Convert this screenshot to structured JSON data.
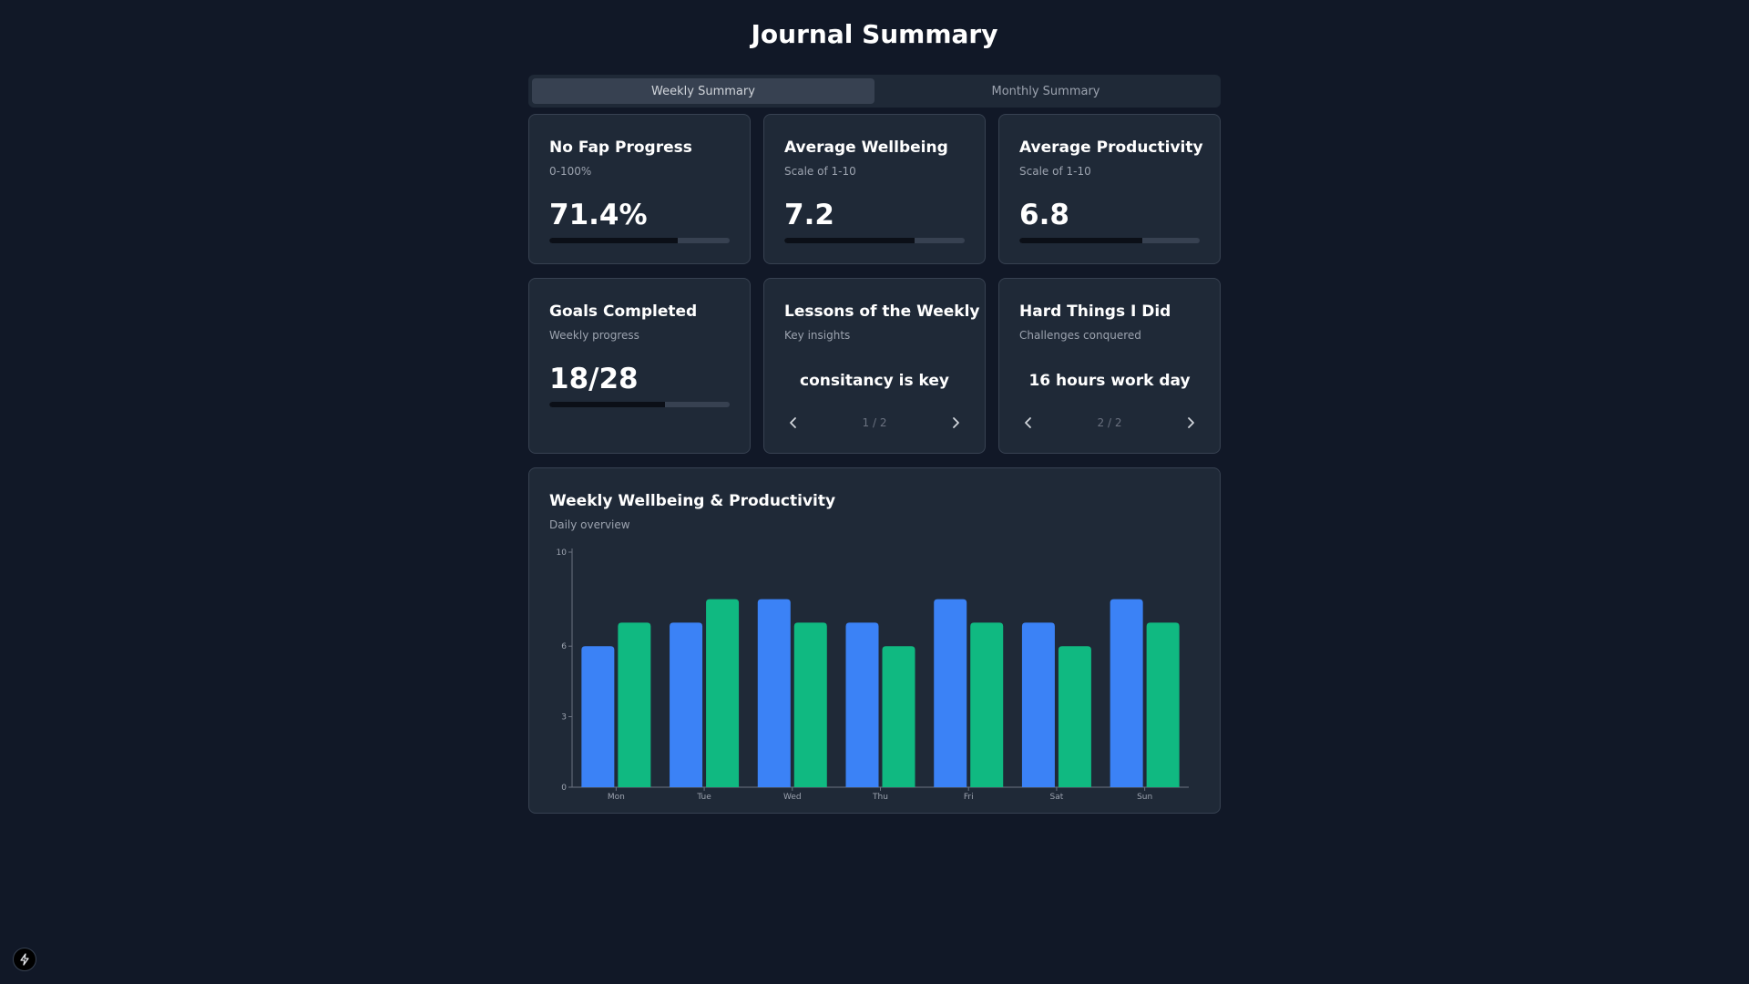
{
  "title": "Journal Summary",
  "tabs": [
    {
      "label": "Weekly Summary",
      "active": true
    },
    {
      "label": "Monthly Summary",
      "active": false
    }
  ],
  "cards": {
    "nofap": {
      "title": "No Fap Progress",
      "subtitle": "0-100%",
      "value": "71.4%",
      "progress": 0.714
    },
    "wellbeing": {
      "title": "Average Wellbeing",
      "subtitle": "Scale of 1-10",
      "value": "7.2",
      "progress": 0.72
    },
    "productivity": {
      "title": "Average Productivity",
      "subtitle": "Scale of 1-10",
      "value": "6.8",
      "progress": 0.68
    },
    "goals": {
      "title": "Goals Completed",
      "subtitle": "Weekly progress",
      "value": "18/28",
      "progress": 0.643
    },
    "lessons": {
      "title": "Lessons of the Weekly",
      "subtitle": "Key insights",
      "text": "consitancy is key",
      "page": "1 / 2"
    },
    "hard_things": {
      "title": "Hard Things I Did",
      "subtitle": "Challenges conquered",
      "text": "16 hours work day",
      "page": "2 / 2"
    }
  },
  "chart_card": {
    "title": "Weekly Wellbeing & Productivity",
    "subtitle": "Daily overview"
  },
  "chart_data": {
    "type": "bar",
    "categories": [
      "Mon",
      "Tue",
      "Wed",
      "Thu",
      "Fri",
      "Sat",
      "Sun"
    ],
    "series": [
      {
        "values": [
          6,
          7,
          8,
          7,
          8,
          7,
          8
        ],
        "color": "#3b82f6"
      },
      {
        "values": [
          7,
          8,
          7,
          6,
          7,
          6,
          7
        ],
        "color": "#10b981"
      }
    ],
    "yticks": [
      0,
      3,
      6,
      10
    ],
    "ylim": [
      0,
      10
    ],
    "grid": false
  },
  "icons": {
    "prev": "chevron-left-icon",
    "next": "chevron-right-icon",
    "bolt": "bolt-icon"
  }
}
